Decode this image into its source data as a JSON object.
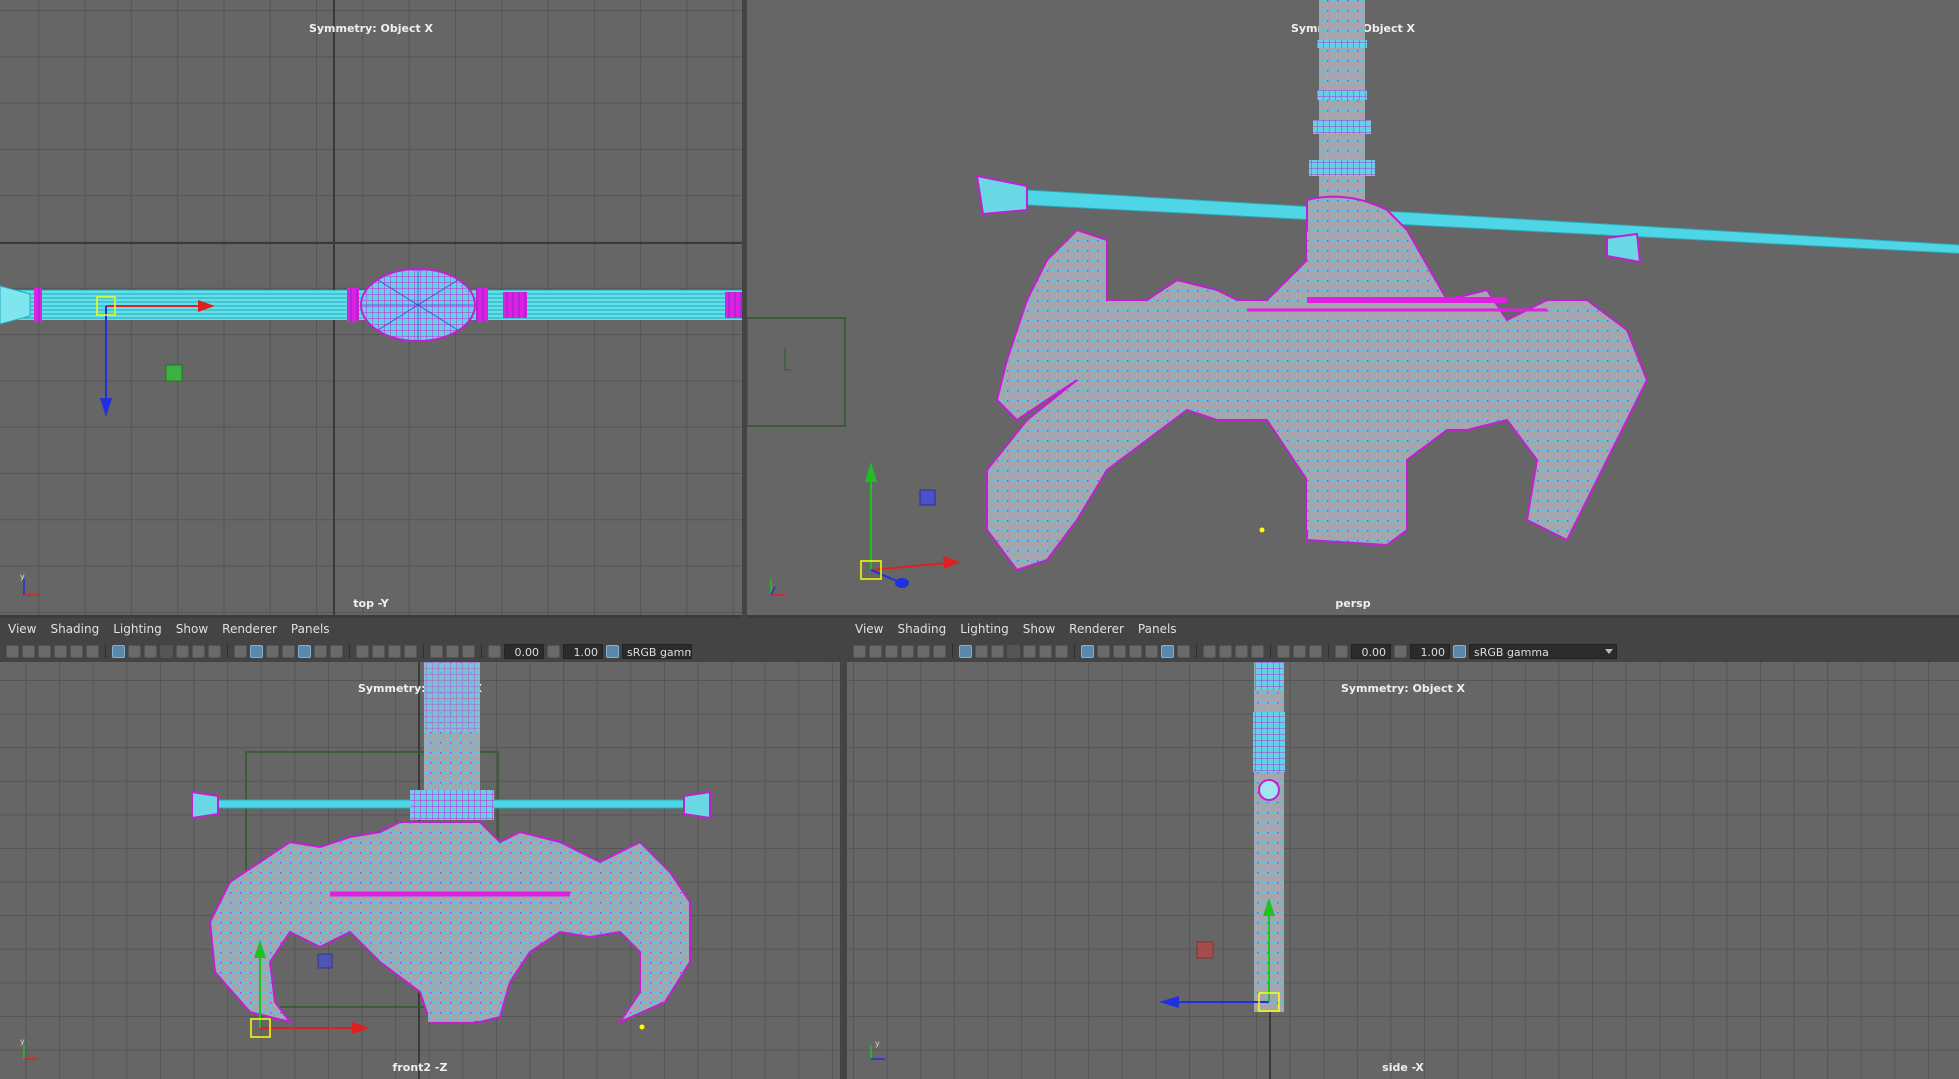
{
  "viewports": {
    "top": {
      "symmetry_label": "Symmetry: Object X",
      "camera_label": "top -Y"
    },
    "persp": {
      "symmetry_label": "Symmetry: Object X",
      "camera_label": "persp"
    },
    "front": {
      "symmetry_label": "Symmetry: Object X",
      "camera_label": "front2 -Z"
    },
    "side": {
      "symmetry_label": "Symmetry: Object X",
      "camera_label": "side -X"
    }
  },
  "panel_menu": [
    "View",
    "Shading",
    "Lighting",
    "Show",
    "Renderer",
    "Panels"
  ],
  "toolbar": {
    "exposure": "0.00",
    "gamma_value": "1.00",
    "color_space": "sRGB gamma",
    "color_space_truncated": "sRGB gamma"
  },
  "axis_labels": {
    "y": "y",
    "x": "x"
  },
  "colors": {
    "viewport_bg": "#666666",
    "mesh_wire": "#3fd8e8",
    "mesh_vertex": "#e020e0",
    "mesh_fill": "#a8a8b0",
    "manip_x": "#e02020",
    "manip_y": "#20c020",
    "manip_z": "#2030e0",
    "selection": "#ffff00"
  }
}
